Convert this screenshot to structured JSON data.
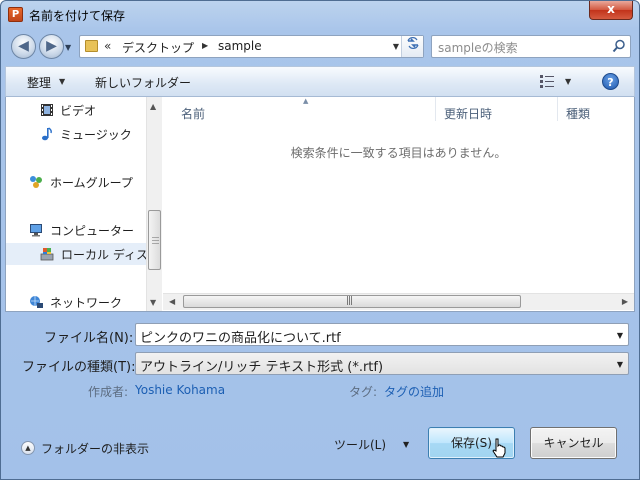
{
  "window": {
    "title": "名前を付けて保存",
    "app_icon_letter": "P",
    "close_glyph": "x"
  },
  "nav": {
    "back_glyph": "◀",
    "forward_glyph": "▶",
    "address": {
      "overflow_glyph": "«",
      "crumbs": [
        "デスクトップ",
        "sample"
      ]
    },
    "search": {
      "placeholder": "sampleの検索"
    }
  },
  "toolbar": {
    "organize_label": "整理",
    "new_folder_label": "新しいフォルダー",
    "help_glyph": "?"
  },
  "nav_pane": {
    "items": [
      {
        "label": "ビデオ",
        "icon": "video-icon"
      },
      {
        "label": "ミュージック",
        "icon": "music-icon"
      },
      {
        "label": "ホームグループ",
        "icon": "homegroup-icon"
      },
      {
        "label": "コンピューター",
        "icon": "computer-icon"
      },
      {
        "label": "ローカル ディスク",
        "icon": "local-disk-icon"
      },
      {
        "label": "ネットワーク",
        "icon": "network-icon"
      }
    ]
  },
  "file_list": {
    "columns": [
      "名前",
      "更新日時",
      "種類"
    ],
    "empty_message": "検索条件に一致する項目はありません。"
  },
  "form": {
    "filename_label": "ファイル名(N):",
    "filename_value": "ピンクのワニの商品化について.rtf",
    "filetype_label": "ファイルの種類(T):",
    "filetype_value": "アウトライン/リッチ テキスト形式 (*.rtf)",
    "author_label": "作成者:",
    "author_value": "Yoshie Kohama",
    "tags_label": "タグ:",
    "tags_value": "タグの追加"
  },
  "footer": {
    "hide_folders_label": "フォルダーの非表示",
    "tools_label": "ツール(L)",
    "save_label": "保存(S)",
    "cancel_label": "キャンセル"
  },
  "colors": {
    "chrome": "#a9c5ea",
    "close_button": "#c2331b",
    "link": "#1c5fb3",
    "save_button": "#bee6fd"
  }
}
